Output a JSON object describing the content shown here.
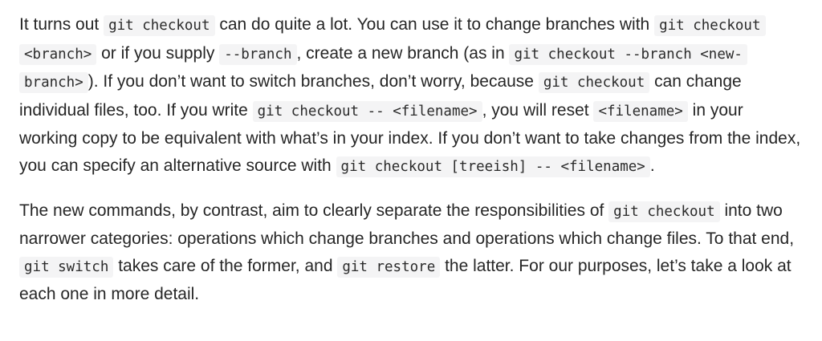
{
  "article": {
    "paragraphs": [
      {
        "segments": [
          {
            "text": "It turns out "
          },
          {
            "code": "git checkout"
          },
          {
            "text": " can do quite a lot. You can use it to change branches with "
          },
          {
            "code": "git checkout <branch>"
          },
          {
            "text": " or if you supply "
          },
          {
            "code": "--branch"
          },
          {
            "text": ", create a new branch (as in "
          },
          {
            "code": "git checkout --branch <new-branch>"
          },
          {
            "text": "). If you don’t want to switch branches, don’t worry, because "
          },
          {
            "code": "git checkout"
          },
          {
            "text": " can change individual files, too.  If you write "
          },
          {
            "code": "git checkout -- <filename>"
          },
          {
            "text": ", you will reset "
          },
          {
            "code": "<filename>"
          },
          {
            "text": " in your working copy to be equivalent with what’s in your index. If you don’t want to take changes from the index, you can specify an alternative source with "
          },
          {
            "code": "git checkout [treeish] -- <filename>"
          },
          {
            "text": "."
          }
        ]
      },
      {
        "segments": [
          {
            "text": "The new commands, by contrast, aim to clearly separate the responsibilities of "
          },
          {
            "code": "git checkout"
          },
          {
            "text": " into two narrower categories: operations which change branches and operations which change files. To that end, "
          },
          {
            "code": "git switch"
          },
          {
            "text": " takes care of the former, and "
          },
          {
            "code": "git restore"
          },
          {
            "text": " the latter. For our purposes, let’s take a look at each one in more detail."
          }
        ]
      }
    ]
  }
}
